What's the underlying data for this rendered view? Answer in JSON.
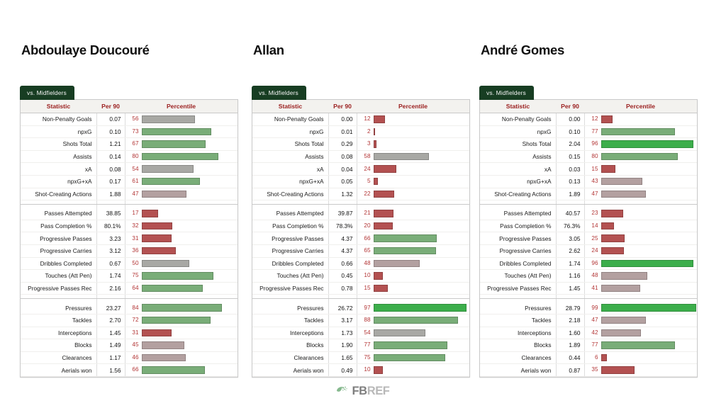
{
  "footer": {
    "logo_text_primary": "FB",
    "logo_text_secondary": "REF",
    "logo_icon": "fbref-leaf-icon"
  },
  "columns": {
    "statistic": "Statistic",
    "per90": "Per 90",
    "percentile": "Percentile"
  },
  "tab_label": "vs. Midfielders",
  "colors": {
    "tab_bg": "#173d22",
    "header_text": "#9b2020",
    "percentile_number": "#b33636",
    "bar_high_green": "#3cae4b",
    "bar_mid_green": "#76ab75",
    "bar_neutral_gray": "#a6a6a2",
    "bar_mauve": "#b09a9a",
    "bar_red": "#b35151"
  },
  "players": [
    {
      "name": "Abdoulaye Doucouré",
      "tab": "vs. Midfielders",
      "groups": [
        {
          "rows": [
            {
              "stat": "Non-Penalty Goals",
              "per90": "0.07",
              "pct": 56
            },
            {
              "stat": "npxG",
              "per90": "0.10",
              "pct": 73
            },
            {
              "stat": "Shots Total",
              "per90": "1.21",
              "pct": 67
            },
            {
              "stat": "Assists",
              "per90": "0.14",
              "pct": 80
            },
            {
              "stat": "xA",
              "per90": "0.08",
              "pct": 54
            },
            {
              "stat": "npxG+xA",
              "per90": "0.17",
              "pct": 61
            },
            {
              "stat": "Shot-Creating Actions",
              "per90": "1.88",
              "pct": 47
            }
          ]
        },
        {
          "rows": [
            {
              "stat": "Passes Attempted",
              "per90": "38.85",
              "pct": 17
            },
            {
              "stat": "Pass Completion %",
              "per90": "80.1%",
              "pct": 32
            },
            {
              "stat": "Progressive Passes",
              "per90": "3.23",
              "pct": 31
            },
            {
              "stat": "Progressive Carries",
              "per90": "3.12",
              "pct": 36
            },
            {
              "stat": "Dribbles Completed",
              "per90": "0.67",
              "pct": 50
            },
            {
              "stat": "Touches (Att Pen)",
              "per90": "1.74",
              "pct": 75
            },
            {
              "stat": "Progressive Passes Rec",
              "per90": "2.16",
              "pct": 64
            }
          ]
        },
        {
          "rows": [
            {
              "stat": "Pressures",
              "per90": "23.27",
              "pct": 84
            },
            {
              "stat": "Tackles",
              "per90": "2.70",
              "pct": 72
            },
            {
              "stat": "Interceptions",
              "per90": "1.45",
              "pct": 31
            },
            {
              "stat": "Blocks",
              "per90": "1.49",
              "pct": 45
            },
            {
              "stat": "Clearances",
              "per90": "1.17",
              "pct": 46
            },
            {
              "stat": "Aerials won",
              "per90": "1.56",
              "pct": 66
            }
          ]
        }
      ]
    },
    {
      "name": "Allan",
      "tab": "vs. Midfielders",
      "groups": [
        {
          "rows": [
            {
              "stat": "Non-Penalty Goals",
              "per90": "0.00",
              "pct": 12
            },
            {
              "stat": "npxG",
              "per90": "0.01",
              "pct": 2
            },
            {
              "stat": "Shots Total",
              "per90": "0.29",
              "pct": 3
            },
            {
              "stat": "Assists",
              "per90": "0.08",
              "pct": 58
            },
            {
              "stat": "xA",
              "per90": "0.04",
              "pct": 24
            },
            {
              "stat": "npxG+xA",
              "per90": "0.05",
              "pct": 5
            },
            {
              "stat": "Shot-Creating Actions",
              "per90": "1.32",
              "pct": 22
            }
          ]
        },
        {
          "rows": [
            {
              "stat": "Passes Attempted",
              "per90": "39.87",
              "pct": 21
            },
            {
              "stat": "Pass Completion %",
              "per90": "78.3%",
              "pct": 20
            },
            {
              "stat": "Progressive Passes",
              "per90": "4.37",
              "pct": 66
            },
            {
              "stat": "Progressive Carries",
              "per90": "4.37",
              "pct": 65
            },
            {
              "stat": "Dribbles Completed",
              "per90": "0.66",
              "pct": 48
            },
            {
              "stat": "Touches (Att Pen)",
              "per90": "0.45",
              "pct": 10
            },
            {
              "stat": "Progressive Passes Rec",
              "per90": "0.78",
              "pct": 15
            }
          ]
        },
        {
          "rows": [
            {
              "stat": "Pressures",
              "per90": "26.72",
              "pct": 97
            },
            {
              "stat": "Tackles",
              "per90": "3.17",
              "pct": 88
            },
            {
              "stat": "Interceptions",
              "per90": "1.73",
              "pct": 54
            },
            {
              "stat": "Blocks",
              "per90": "1.90",
              "pct": 77
            },
            {
              "stat": "Clearances",
              "per90": "1.65",
              "pct": 75
            },
            {
              "stat": "Aerials won",
              "per90": "0.49",
              "pct": 10
            }
          ]
        }
      ]
    },
    {
      "name": "André Gomes",
      "tab": "vs. Midfielders",
      "groups": [
        {
          "rows": [
            {
              "stat": "Non-Penalty Goals",
              "per90": "0.00",
              "pct": 12
            },
            {
              "stat": "npxG",
              "per90": "0.10",
              "pct": 77
            },
            {
              "stat": "Shots Total",
              "per90": "2.04",
              "pct": 96
            },
            {
              "stat": "Assists",
              "per90": "0.15",
              "pct": 80
            },
            {
              "stat": "xA",
              "per90": "0.03",
              "pct": 15
            },
            {
              "stat": "npxG+xA",
              "per90": "0.13",
              "pct": 43
            },
            {
              "stat": "Shot-Creating Actions",
              "per90": "1.89",
              "pct": 47
            }
          ]
        },
        {
          "rows": [
            {
              "stat": "Passes Attempted",
              "per90": "40.57",
              "pct": 23
            },
            {
              "stat": "Pass Completion %",
              "per90": "76.3%",
              "pct": 14
            },
            {
              "stat": "Progressive Passes",
              "per90": "3.05",
              "pct": 25
            },
            {
              "stat": "Progressive Carries",
              "per90": "2.62",
              "pct": 24
            },
            {
              "stat": "Dribbles Completed",
              "per90": "1.74",
              "pct": 96
            },
            {
              "stat": "Touches (Att Pen)",
              "per90": "1.16",
              "pct": 48
            },
            {
              "stat": "Progressive Passes Rec",
              "per90": "1.45",
              "pct": 41
            }
          ]
        },
        {
          "rows": [
            {
              "stat": "Pressures",
              "per90": "28.79",
              "pct": 99
            },
            {
              "stat": "Tackles",
              "per90": "2.18",
              "pct": 47
            },
            {
              "stat": "Interceptions",
              "per90": "1.60",
              "pct": 42
            },
            {
              "stat": "Blocks",
              "per90": "1.89",
              "pct": 77
            },
            {
              "stat": "Clearances",
              "per90": "0.44",
              "pct": 6
            },
            {
              "stat": "Aerials won",
              "per90": "0.87",
              "pct": 35
            }
          ]
        }
      ]
    }
  ],
  "chart_data": {
    "type": "bar",
    "title": "FBref percentile scouting report comparison — Everton midfielders",
    "subtitle": "vs. Midfielders",
    "xlabel": "Percentile",
    "ylabel": "Statistic",
    "xlim": [
      0,
      100
    ],
    "grid": false,
    "legend": "none",
    "categories": [
      "Non-Penalty Goals",
      "npxG",
      "Shots Total",
      "Assists",
      "xA",
      "npxG+xA",
      "Shot-Creating Actions",
      "Passes Attempted",
      "Pass Completion %",
      "Progressive Passes",
      "Progressive Carries",
      "Dribbles Completed",
      "Touches (Att Pen)",
      "Progressive Passes Rec",
      "Pressures",
      "Tackles",
      "Interceptions",
      "Blocks",
      "Clearances",
      "Aerials won"
    ],
    "series": [
      {
        "name": "Abdoulaye Doucouré",
        "values": [
          56,
          73,
          67,
          80,
          54,
          61,
          47,
          17,
          32,
          31,
          36,
          50,
          75,
          64,
          84,
          72,
          31,
          45,
          46,
          66
        ],
        "per90": [
          "0.07",
          "0.10",
          "1.21",
          "0.14",
          "0.08",
          "0.17",
          "1.88",
          "38.85",
          "80.1%",
          "3.23",
          "3.12",
          "0.67",
          "1.74",
          "2.16",
          "23.27",
          "2.70",
          "1.45",
          "1.49",
          "1.17",
          "1.56"
        ]
      },
      {
        "name": "Allan",
        "values": [
          12,
          2,
          3,
          58,
          24,
          5,
          22,
          21,
          20,
          66,
          65,
          48,
          10,
          15,
          97,
          88,
          54,
          77,
          75,
          10
        ],
        "per90": [
          "0.00",
          "0.01",
          "0.29",
          "0.08",
          "0.04",
          "0.05",
          "1.32",
          "39.87",
          "78.3%",
          "4.37",
          "4.37",
          "0.66",
          "0.45",
          "0.78",
          "26.72",
          "3.17",
          "1.73",
          "1.90",
          "1.65",
          "0.49"
        ]
      },
      {
        "name": "André Gomes",
        "values": [
          12,
          77,
          96,
          80,
          15,
          43,
          47,
          23,
          14,
          25,
          24,
          96,
          48,
          41,
          99,
          47,
          42,
          77,
          6,
          35
        ],
        "per90": [
          "0.00",
          "0.10",
          "2.04",
          "0.15",
          "0.03",
          "0.13",
          "1.89",
          "40.57",
          "76.3%",
          "3.05",
          "2.62",
          "1.74",
          "1.16",
          "1.45",
          "28.79",
          "2.18",
          "1.60",
          "1.89",
          "0.44",
          "0.87"
        ]
      }
    ]
  }
}
